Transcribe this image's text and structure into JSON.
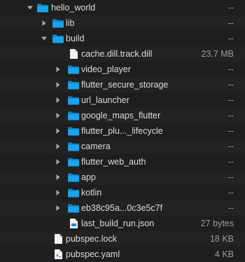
{
  "rows": [
    {
      "name": "hello_world",
      "size": "--",
      "type": "folder",
      "state": "open",
      "depth": 0
    },
    {
      "name": "lib",
      "size": "--",
      "type": "folder",
      "state": "closed",
      "depth": 1
    },
    {
      "name": "build",
      "size": "--",
      "type": "folder",
      "state": "open",
      "depth": 1
    },
    {
      "name": "cache.dill.track.dill",
      "size": "23.7 MB",
      "type": "file",
      "depth": 2
    },
    {
      "name": "video_player",
      "size": "--",
      "type": "folder",
      "state": "closed",
      "depth": 2
    },
    {
      "name": "flutter_secure_storage",
      "size": "--",
      "type": "folder",
      "state": "closed",
      "depth": 2
    },
    {
      "name": "url_launcher",
      "size": "--",
      "type": "folder",
      "state": "closed",
      "depth": 2
    },
    {
      "name": "google_maps_flutter",
      "size": "--",
      "type": "folder",
      "state": "closed",
      "depth": 2
    },
    {
      "name": "flutter_plu..._lifecycle",
      "size": "--",
      "type": "folder",
      "state": "closed",
      "depth": 2
    },
    {
      "name": "camera",
      "size": "--",
      "type": "folder",
      "state": "closed",
      "depth": 2
    },
    {
      "name": "flutter_web_auth",
      "size": "--",
      "type": "folder",
      "state": "closed",
      "depth": 2
    },
    {
      "name": "app",
      "size": "--",
      "type": "folder",
      "state": "closed",
      "depth": 2
    },
    {
      "name": "kotlin",
      "size": "--",
      "type": "folder",
      "state": "closed",
      "depth": 2
    },
    {
      "name": "eb38c95a...0c3e5c7f",
      "size": "--",
      "type": "folder",
      "state": "closed",
      "depth": 2
    },
    {
      "name": "last_build_run.json",
      "size": "27 bytes",
      "type": "json-file",
      "depth": 2
    },
    {
      "name": "pubspec.lock",
      "size": "18 KB",
      "type": "file",
      "depth": 1
    },
    {
      "name": "pubspec.yaml",
      "size": "4 KB",
      "type": "yaml-file",
      "depth": 1
    }
  ],
  "colors": {
    "folder": "#1aa3e8",
    "folder_tab": "#0f86c8",
    "file": "#f2f2f2",
    "disclosure": "#a8a8a8"
  }
}
